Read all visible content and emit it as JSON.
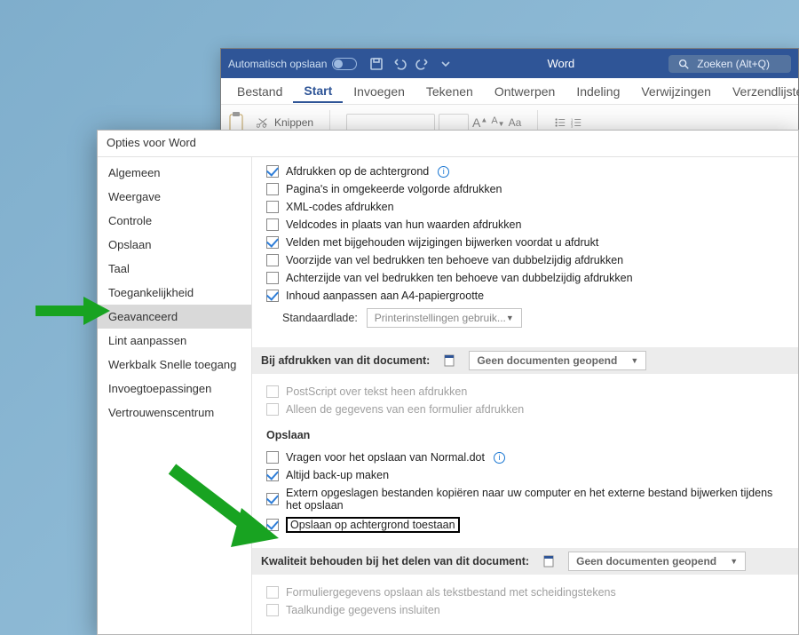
{
  "word": {
    "autosave_label": "Automatisch opslaan",
    "title": "Word",
    "search_placeholder": "Zoeken (Alt+Q)",
    "tabs": {
      "bestand": "Bestand",
      "start": "Start",
      "invoegen": "Invoegen",
      "tekenen": "Tekenen",
      "ontwerpen": "Ontwerpen",
      "indeling": "Indeling",
      "verwijzingen": "Verwijzingen",
      "verzendlijsten": "Verzendlijsten"
    },
    "ribbon": {
      "knippen": "Knippen",
      "font_up": "A",
      "font_down": "A",
      "font_aa": "Aa"
    }
  },
  "dialog": {
    "title": "Opties voor Word",
    "nav": {
      "algemeen": "Algemeen",
      "weergave": "Weergave",
      "controle": "Controle",
      "opslaan": "Opslaan",
      "taal": "Taal",
      "toegankelijkheid": "Toegankelijkheid",
      "geavanceerd": "Geavanceerd",
      "lint": "Lint aanpassen",
      "werkbalk": "Werkbalk Snelle toegang",
      "invoegtoepassingen": "Invoegtoepassingen",
      "vertrouwenscentrum": "Vertrouwenscentrum"
    },
    "print_opts": {
      "afdrukken_achtergrond": "Afdrukken op de achtergrond",
      "paginas_omgekeerd": "Pagina's in omgekeerde volgorde afdrukken",
      "xml_codes": "XML-codes afdrukken",
      "veldcodes": "Veldcodes in plaats van hun waarden afdrukken",
      "velden_bijwerken": "Velden met bijgehouden wijzigingen bijwerken voordat u afdrukt",
      "voorzijde": "Voorzijde van vel bedrukken ten behoeve van dubbelzijdig afdrukken",
      "achterzijde": "Achterzijde van vel bedrukken ten behoeve van dubbelzijdig afdrukken",
      "a4": "Inhoud aanpassen aan A4-papiergrootte",
      "standaardlade_label": "Standaardlade:",
      "standaardlade_value": "Printerinstellingen gebruik..."
    },
    "section_printdoc": {
      "title": "Bij afdrukken van dit document:",
      "combo": "Geen documenten geopend",
      "postscript": "PostScript over tekst heen afdrukken",
      "alleen_formulier": "Alleen de gegevens van een formulier afdrukken"
    },
    "section_opslaan": {
      "title": "Opslaan",
      "vragen_normal": "Vragen voor het opslaan van Normal.dot",
      "altijd_backup": "Altijd back-up maken",
      "extern": "Extern opgeslagen bestanden kopiëren naar uw computer en het externe bestand bijwerken tijdens het opslaan",
      "opslaan_achtergrond": "Opslaan op achtergrond toestaan"
    },
    "section_kwaliteit": {
      "title": "Kwaliteit behouden bij het delen van dit document:",
      "combo": "Geen documenten geopend",
      "formulier_scheiding": "Formuliergegevens opslaan als tekstbestand met scheidingstekens",
      "taalkundige": "Taalkundige gegevens insluiten"
    }
  }
}
